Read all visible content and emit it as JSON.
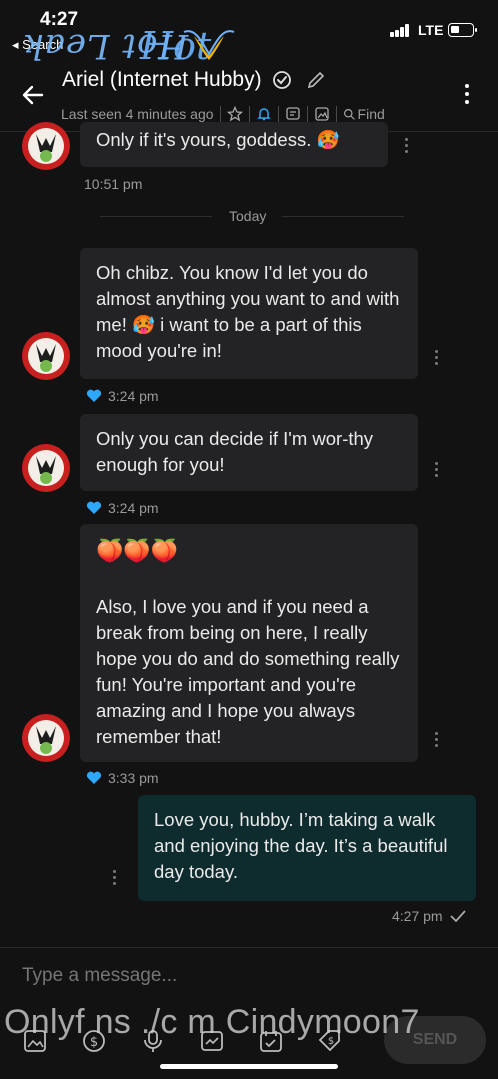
{
  "status_bar": {
    "time": "4:27",
    "back_label": "◂ Search",
    "network": "LTE"
  },
  "watermark": {
    "top_left": "Hot Leak",
    "top_right": "Hot",
    "bottom": "Onlyf ns ./c m Cindymoon7"
  },
  "header": {
    "contact_name": "Ariel (Internet Hubby)",
    "last_seen": "Last seen 4 minutes ago",
    "find_label": "Find"
  },
  "messages": [
    {
      "text": "Only if it's yours, goddess. 🥵",
      "time": "10:51 pm",
      "direction": "in"
    },
    {
      "text": "Oh chibz. You know I'd let you do almost anything you want to and with me! 🥵 i want to be a part of this mood you're in!",
      "time": "3:24 pm",
      "direction": "in"
    },
    {
      "text": "Only you can decide if I'm wor-thy enough for you!",
      "time": "3:24 pm",
      "direction": "in"
    },
    {
      "emoji": "🍑🍑🍑",
      "text": "Also, I love you and if you need a break from being on here, I really hope you do and do something really fun! You're important and you're amazing and I hope you always remember that!",
      "time": "3:33 pm",
      "direction": "in"
    },
    {
      "text": "Love you, hubby. I’m taking a walk and enjoying the day. It’s a beautiful day today.",
      "time": "4:27 pm",
      "direction": "out"
    }
  ],
  "day_divider": "Today",
  "composer": {
    "placeholder": "Type a message...",
    "send_label": "SEND"
  },
  "colors": {
    "background": "#121212",
    "incoming_bubble": "#232325",
    "outgoing_bubble": "#0e2b2e",
    "accent": "#2ea8ff"
  }
}
